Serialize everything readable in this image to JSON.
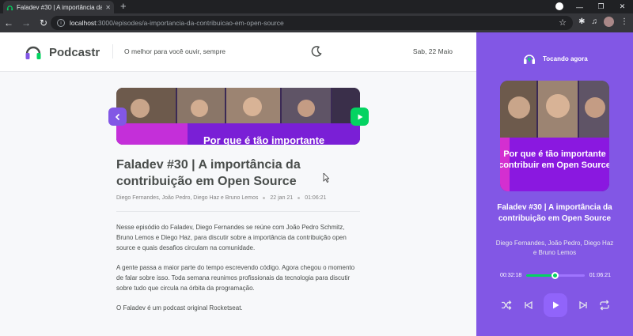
{
  "browser": {
    "tab_title": "Faladev #30 | A importância da c",
    "url_host": "localhost",
    "url_rest": ":3000/episodes/a-importancia-da-contribuicao-em-open-source",
    "window_minimize": "—",
    "window_maximize": "❐",
    "window_close": "✕"
  },
  "header": {
    "brand": "Podcastr",
    "tagline": "O melhor para você ouvir, sempre",
    "date": "Sab, 22 Maio"
  },
  "episode": {
    "title": "Faladev #30 | A importância da contribuição em Open Source",
    "members": "Diego Fernandes, João Pedro, Diego Haz e Bruno Lemos",
    "published": "22 jan 21",
    "duration": "01:06:21",
    "thumbnail_caption": "Por que é tão importante",
    "description": [
      "Nesse episódio do Faladev, Diego Fernandes se reúne com João Pedro Schmitz, Bruno Lemos e Diego Haz, para discutir sobre a importância da contribuição open source e quais desafios circulam na comunidade.",
      "A gente passa a maior parte do tempo escrevendo código. Agora chegou o momento de falar sobre isso. Toda semana reunimos profissionais da tecnologia para discutir sobre tudo que circula na órbita da programação.",
      "O Faladev é um podcast original Rocketseat."
    ]
  },
  "player": {
    "label": "Tocando agora",
    "cover_caption_1": "Por que é tão importante",
    "cover_caption_2": "contribuir em Open Source",
    "title": "Faladev #30 | A importância da contribuição em Open Source",
    "members": "Diego Fernandes, João Pedro, Diego Haz e Bruno Lemos",
    "current_time": "00:32:18",
    "total_time": "01:06:21",
    "progress": 0.49
  },
  "colors": {
    "purple": "#8257e5",
    "green": "#04d361"
  }
}
